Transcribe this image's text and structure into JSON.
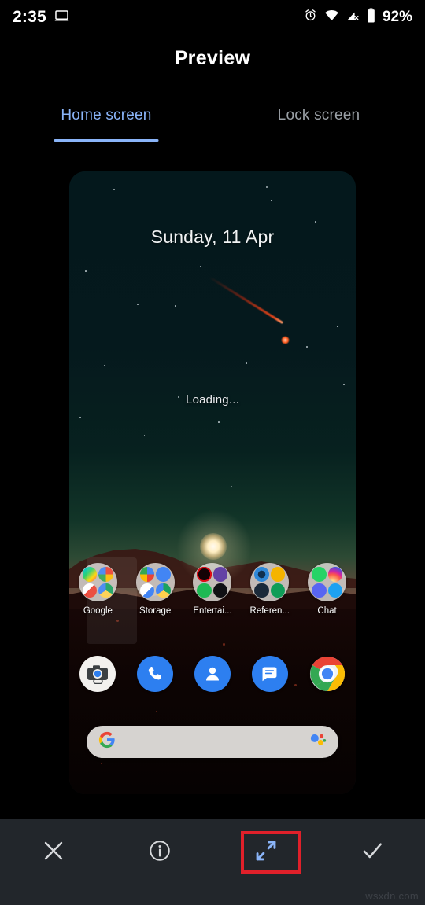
{
  "statusbar": {
    "time": "2:35",
    "battery_percent": "92%",
    "icons": [
      "cast-screen-icon",
      "alarm-icon",
      "wifi-icon",
      "signal-off-icon",
      "battery-icon"
    ]
  },
  "header": {
    "title": "Preview"
  },
  "tabs": [
    {
      "label": "Home screen",
      "active": true
    },
    {
      "label": "Lock screen",
      "active": false
    }
  ],
  "preview": {
    "wallpaper_name": "night-sky-meteor-sunset",
    "date_text": "Sunday, 11 Apr",
    "loading_text": "Loading...",
    "folders": [
      {
        "label": "Google",
        "apps": [
          "play-store-icon",
          "google-g-icon",
          "gmail-icon",
          "drive-icon"
        ],
        "colors": [
          "#6aba6e",
          "#ffffff",
          "#ea4335",
          "#1aa260"
        ]
      },
      {
        "label": "Storage",
        "apps": [
          "photos-icon",
          "files-icon",
          "docs-icon",
          "drive-icon"
        ],
        "colors": [
          "#4285f4",
          "#4285f4",
          "#ffffff",
          "#fbbc04"
        ]
      },
      {
        "label": "Entertai...",
        "apps": [
          "netflix-icon",
          "twitch-icon",
          "spotify-icon",
          "video-player-icon"
        ],
        "colors": [
          "#1a0205",
          "#6441a5",
          "#1db954",
          "#111111"
        ]
      },
      {
        "label": "Referen...",
        "apps": [
          "scholar-icon",
          "translate-icon",
          "news-icon",
          "sheets-icon"
        ],
        "colors": [
          "#2f88d8",
          "#f5b400",
          "#1b1b1f",
          "#0f9d58"
        ]
      },
      {
        "label": "Chat",
        "apps": [
          "whatsapp-icon",
          "instagram-icon",
          "discord-icon",
          "twitter-icon"
        ],
        "colors": [
          "#25d366",
          "#c13584",
          "#5865f2",
          "#1da1f2"
        ]
      }
    ],
    "dock": [
      {
        "label": "Camera Go",
        "icon": "camera-go-icon",
        "style": "white"
      },
      {
        "label": "Phone",
        "icon": "phone-icon",
        "style": "blue"
      },
      {
        "label": "Contacts",
        "icon": "contacts-icon",
        "style": "blue"
      },
      {
        "label": "Messages",
        "icon": "messages-icon",
        "style": "blue"
      },
      {
        "label": "Chrome",
        "icon": "chrome-icon",
        "style": "chrome"
      }
    ],
    "search": {
      "left_icon": "google-g-icon",
      "right_icon": "google-assistant-icon",
      "placeholder": ""
    }
  },
  "toolbar": {
    "buttons": [
      {
        "name": "close-button",
        "icon": "close-icon",
        "label": ""
      },
      {
        "name": "info-button",
        "icon": "info-icon",
        "label": ""
      },
      {
        "name": "expand-button",
        "icon": "expand-icon",
        "label": "",
        "highlighted": true
      },
      {
        "name": "confirm-button",
        "icon": "check-icon",
        "label": ""
      }
    ],
    "highlight_color": "#e0202a"
  },
  "watermark": "wsxdn.com",
  "colors": {
    "accent": "#8ab4f8",
    "inactive_tab": "#9aa0a6",
    "toolbar_bg": "#22262b",
    "page_bg": "#000000"
  }
}
